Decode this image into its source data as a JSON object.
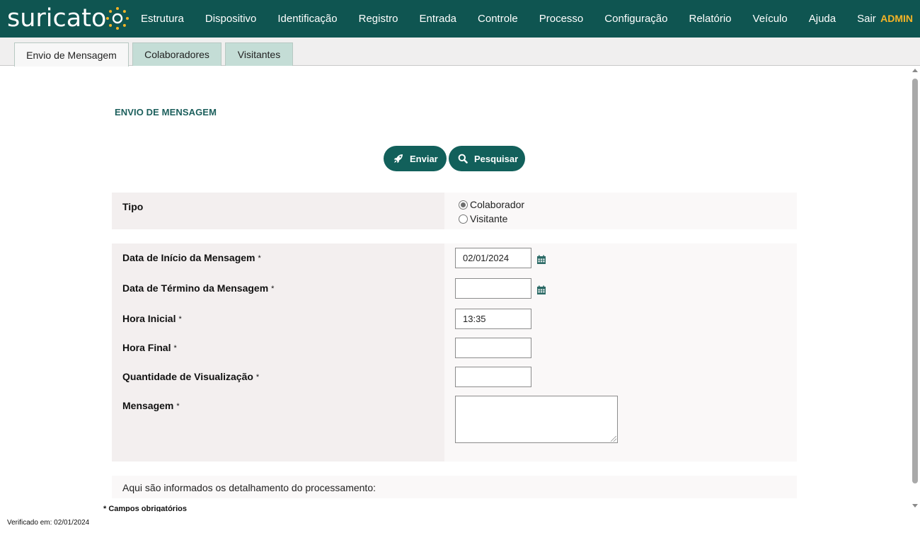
{
  "brand": {
    "logo_text": "suricato",
    "accent": "#f6b426",
    "primary": "#0f5551"
  },
  "nav": {
    "items": [
      "Estrutura",
      "Dispositivo",
      "Identificação",
      "Registro",
      "Entrada",
      "Controle",
      "Processo",
      "Configuração",
      "Relatório",
      "Veículo",
      "Ajuda",
      "Sair"
    ],
    "user": "ADMIN"
  },
  "tabs": [
    {
      "label": "Envio de Mensagem",
      "active": true
    },
    {
      "label": "Colaboradores",
      "active": false
    },
    {
      "label": "Visitantes",
      "active": false
    }
  ],
  "page": {
    "title": "ENVIO DE MENSAGEM"
  },
  "actions": {
    "send_label": "Enviar",
    "send_icon": "rocket-icon",
    "search_label": "Pesquisar",
    "search_icon": "search-icon"
  },
  "form": {
    "tipo": {
      "label": "Tipo",
      "options": [
        "Colaborador",
        "Visitante"
      ],
      "selected": "Colaborador"
    },
    "required_mark": "*",
    "start_date": {
      "label": "Data de Início da Mensagem",
      "value": "02/01/2024"
    },
    "end_date": {
      "label": "Data de Término da Mensagem",
      "value": ""
    },
    "start_time": {
      "label": "Hora Inicial",
      "value": "13:35"
    },
    "end_time": {
      "label": "Hora Final",
      "value": ""
    },
    "view_count": {
      "label": "Quantidade de Visualização",
      "value": ""
    },
    "message": {
      "label": "Mensagem",
      "value": ""
    }
  },
  "info": {
    "text": "Aqui são informados os detalhamento do processamento:"
  },
  "footer": {
    "required_note": "* Campos obrigatórios",
    "verified": "Verificado em: 02/01/2024"
  }
}
